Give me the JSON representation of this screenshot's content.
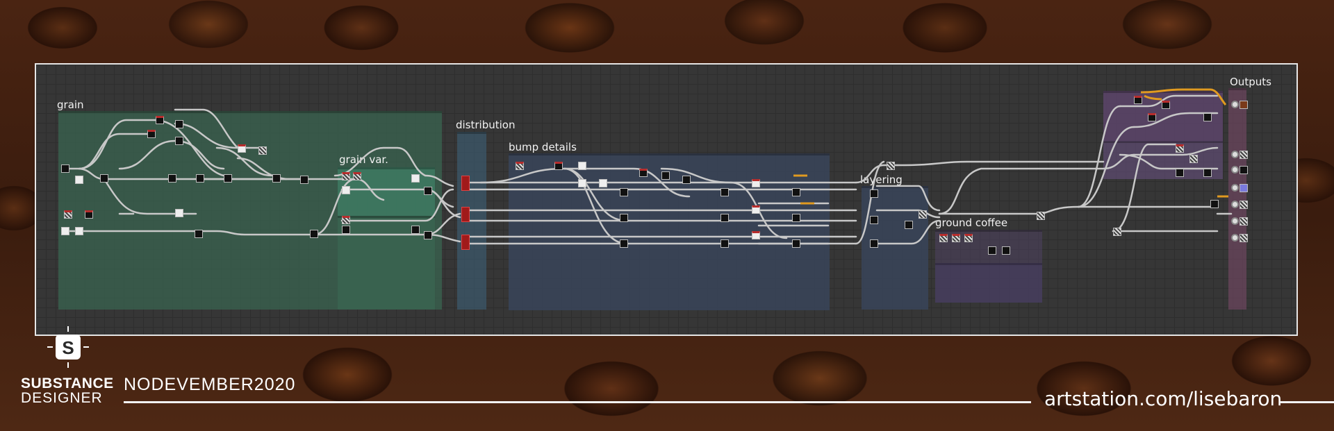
{
  "branding": {
    "product_line1": "SUBSTANCE",
    "product_line2": "DESIGNER",
    "logo_letter": "S",
    "event_tag": "NODEVEMBER2020",
    "url": "artstation.com/lisebaron"
  },
  "frames": {
    "grain": "grain",
    "grain_var": "grain var.",
    "distribution": "distribution",
    "bump_details": "bump details",
    "layering": "layering",
    "ground_coffee": "ground coffee",
    "outputs": "Outputs"
  },
  "colors": {
    "frame_green": "#3a5a4c",
    "frame_teal": "#3a6a58",
    "frame_blue": "#3a475c",
    "frame_purple": "#4c3c56",
    "frame_pink": "#5a3a4c",
    "accent_orange": "#e09a20",
    "link_gray": "#c8c8c8"
  }
}
